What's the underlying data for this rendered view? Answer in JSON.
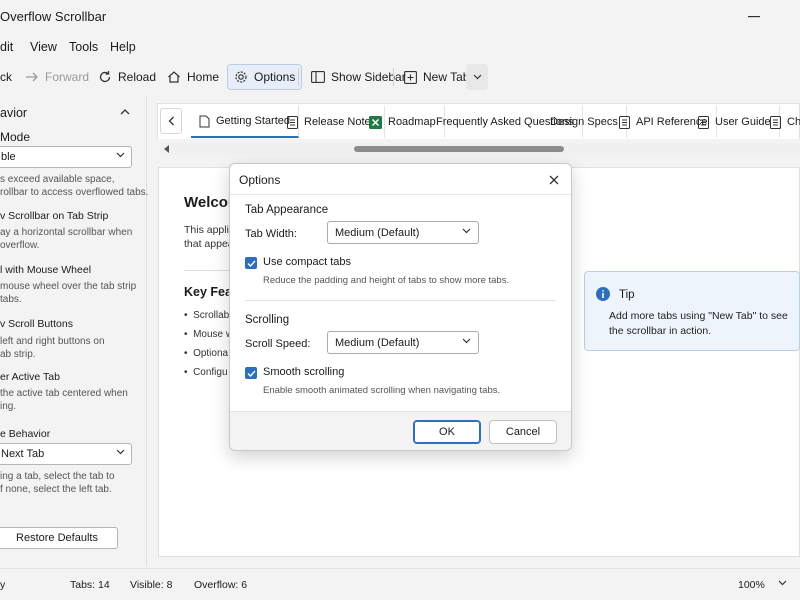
{
  "window": {
    "title": "Overflow Scrollbar"
  },
  "menu": [
    "dit",
    "View",
    "Tools",
    "Help"
  ],
  "toolbar": {
    "back": "ck",
    "forward": "Forward",
    "reload": "Reload",
    "home": "Home",
    "options": "Options",
    "show_sidebar": "Show Sidebar",
    "new_tab": "New Tab"
  },
  "sidebar": {
    "header": "avior",
    "mode_label": "Mode",
    "mode_value": "ble",
    "mode_desc": [
      "s exceed available space,",
      "rollbar to access overflowed tabs."
    ],
    "show_scrollbar": {
      "title": "v Scrollbar on Tab Strip",
      "desc": [
        "ay a horizontal scrollbar when",
        "overflow."
      ]
    },
    "mouse_wheel": {
      "title": "l with Mouse Wheel",
      "desc": [
        "mouse wheel over the tab strip",
        "tabs."
      ]
    },
    "scroll_buttons": {
      "title": "v Scroll Buttons",
      "desc": [
        "left and right buttons on",
        "ab strip."
      ]
    },
    "center_active": {
      "title": "er Active Tab",
      "desc": [
        "the active tab centered when",
        "ing."
      ]
    },
    "close_behavior": {
      "title": "e Behavior",
      "value": "Next Tab",
      "desc": [
        "ing a tab, select the tab to",
        "f none, select the left tab."
      ]
    },
    "restore": "Restore Defaults"
  },
  "tabs": [
    {
      "label": "Getting Started",
      "icon": "document-icon",
      "active": true
    },
    {
      "label": "Release Notes",
      "icon": "notes-icon"
    },
    {
      "label": "Roadmap",
      "icon": "excel-icon"
    },
    {
      "label": "Frequently Asked Questions",
      "icon": "none"
    },
    {
      "label": "Design Specs",
      "icon": "none"
    },
    {
      "label": "API Reference",
      "icon": "document-icon"
    },
    {
      "label": "User Guide",
      "icon": "document-icon"
    },
    {
      "label": "Chang",
      "icon": "document-icon"
    }
  ],
  "page": {
    "title": "Welcom",
    "p1": "This applic",
    "p2": "that appea",
    "features_title": "Key Feat",
    "bullets": [
      "Scrollab",
      "Mouse w",
      "Optiona",
      "Configu"
    ]
  },
  "tip": {
    "title": "Tip",
    "body": "Add more tabs using \"New Tab\" to see the scrollbar in action."
  },
  "dialog": {
    "title": "Options",
    "tab_appearance": "Tab Appearance",
    "tab_width_label": "Tab Width:",
    "tab_width_value": "Medium (Default)",
    "compact_label": "Use compact tabs",
    "compact_hint": "Reduce the padding and height of tabs to show more tabs.",
    "scrolling": "Scrolling",
    "scroll_speed_label": "Scroll Speed:",
    "scroll_speed_value": "Medium (Default)",
    "smooth_label": "Smooth scrolling",
    "smooth_hint": "Enable smooth animated scrolling when navigating tabs.",
    "ok": "OK",
    "cancel": "Cancel"
  },
  "status": {
    "left": "y",
    "tabs": "Tabs: 14",
    "visible": "Visible: 8",
    "overflow": "Overflow: 6",
    "zoom": "100%"
  },
  "colors": {
    "accent": "#2d6fbd",
    "excel": "#1f7a43"
  }
}
